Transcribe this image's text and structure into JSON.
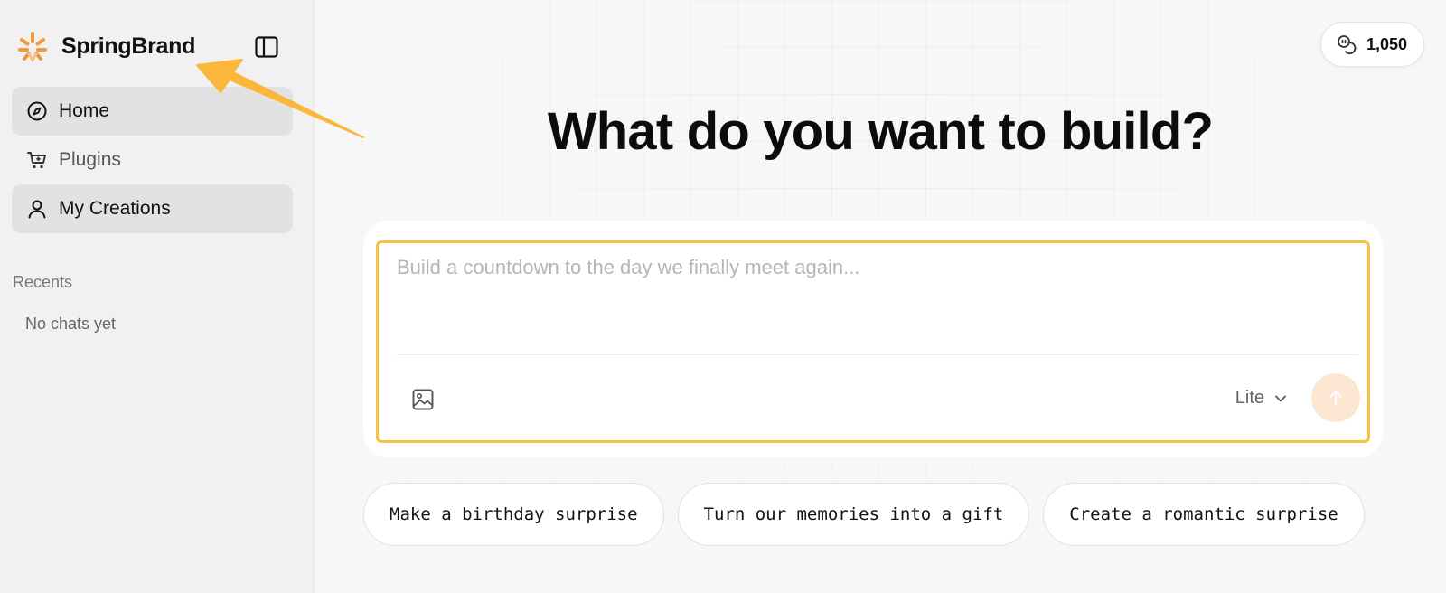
{
  "brand": {
    "name": "SpringBrand",
    "accent": "#f59a3a"
  },
  "sidebar": {
    "items": [
      {
        "label": "Home",
        "icon": "compass-icon",
        "active": true
      },
      {
        "label": "Plugins",
        "icon": "cart-plus-icon",
        "active": false
      },
      {
        "label": "My Creations",
        "icon": "user-icon",
        "active": true
      }
    ],
    "recents_label": "Recents",
    "recents_empty": "No chats yet"
  },
  "header": {
    "credits": "1,050",
    "credits_icon": "coins-icon"
  },
  "main": {
    "headline": "What do you want to build?",
    "composer": {
      "placeholder": "Build a countdown to the day we finally meet again...",
      "value": "",
      "model": "Lite",
      "border_color": "#f8c243",
      "send_color": "#fde6d2"
    },
    "suggestions": [
      "Make a birthday surprise",
      "Turn our memories into a gift",
      "Create a romantic surprise"
    ]
  },
  "annotation": {
    "color": "#fbb63b",
    "icon": "arrow-pointer"
  }
}
